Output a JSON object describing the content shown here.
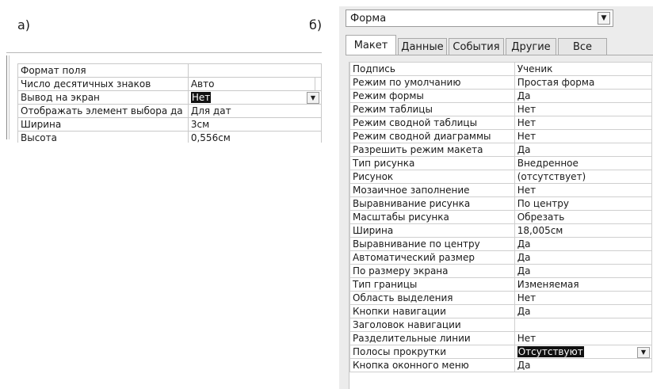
{
  "labels": {
    "a": "а)",
    "b": "б)"
  },
  "left_table": {
    "rows": [
      {
        "name": "Формат поля",
        "value": ""
      },
      {
        "name": "Число десятичных знаков",
        "value": "Авто"
      },
      {
        "name": "Вывод на экран",
        "value": "Нет",
        "selected": true,
        "dropdown": true
      },
      {
        "name": "Отображать элемент выбора да",
        "value": "Для дат"
      },
      {
        "name": "Ширина",
        "value": "3см"
      },
      {
        "name": "Высота",
        "value": "0,556см"
      }
    ]
  },
  "right_panel": {
    "object_combo": "Форма",
    "tabs": [
      {
        "label": "Макет",
        "active": true
      },
      {
        "label": "Данные",
        "active": false
      },
      {
        "label": "События",
        "active": false
      },
      {
        "label": "Другие",
        "active": false
      },
      {
        "label": "Все",
        "active": false
      }
    ],
    "properties": [
      {
        "name": "Подпись",
        "value": "Ученик"
      },
      {
        "name": "Режим по умолчанию",
        "value": "Простая форма"
      },
      {
        "name": "Режим формы",
        "value": "Да"
      },
      {
        "name": "Режим таблицы",
        "value": "Нет"
      },
      {
        "name": "Режим сводной таблицы",
        "value": "Нет"
      },
      {
        "name": "Режим сводной диаграммы",
        "value": "Нет"
      },
      {
        "name": "Разрешить режим макета",
        "value": "Да"
      },
      {
        "name": "Тип рисунка",
        "value": "Внедренное"
      },
      {
        "name": "Рисунок",
        "value": "(отсутствует)"
      },
      {
        "name": "Мозаичное заполнение",
        "value": "Нет"
      },
      {
        "name": "Выравнивание рисунка",
        "value": "По центру"
      },
      {
        "name": "Масштабы рисунка",
        "value": "Обрезать"
      },
      {
        "name": "Ширина",
        "value": "18,005см"
      },
      {
        "name": "Выравнивание по центру",
        "value": "Да"
      },
      {
        "name": "Автоматический размер",
        "value": "Да"
      },
      {
        "name": "По размеру экрана",
        "value": "Да"
      },
      {
        "name": "Тип границы",
        "value": "Изменяемая"
      },
      {
        "name": "Область выделения",
        "value": "Нет"
      },
      {
        "name": "Кнопки навигации",
        "value": "Да"
      },
      {
        "name": "Заголовок навигации",
        "value": ""
      },
      {
        "name": "Разделительные линии",
        "value": "Нет"
      },
      {
        "name": "Полосы прокрутки",
        "value": "Отсутствуют",
        "selected": true,
        "dropdown": true
      },
      {
        "name": "Кнопка оконного меню",
        "value": "Да"
      }
    ]
  },
  "icons": {
    "dropdown": "chevron-down-icon"
  }
}
